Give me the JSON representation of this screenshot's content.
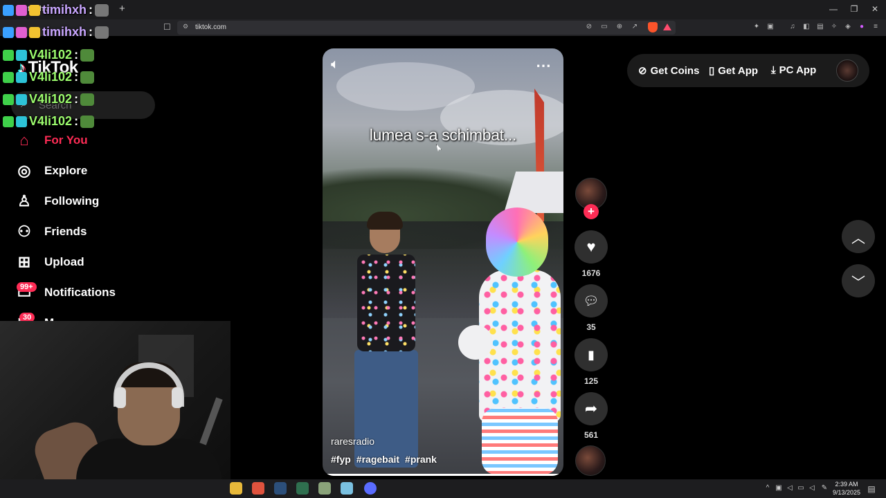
{
  "browser": {
    "tab_title": "timihxh :",
    "new_tab": "+",
    "url": "tiktok.com",
    "window_controls": {
      "minimize": "—",
      "restore": "❐",
      "close": "✕"
    }
  },
  "chat": {
    "lines": [
      {
        "name": "timihxh",
        "sep": ":",
        "color": "#c9a6ff"
      },
      {
        "name": "V4li102",
        "sep": ":",
        "color": "#9dfd6e"
      },
      {
        "name": "V4li102",
        "sep": ":",
        "color": "#9dfd6e"
      },
      {
        "name": "V4li102",
        "sep": ":",
        "color": "#9dfd6e"
      },
      {
        "name": "V4li102",
        "sep": ":",
        "color": "#9dfd6e"
      }
    ]
  },
  "sidebar": {
    "logo": "TikTok",
    "search_placeholder": "Search",
    "items": [
      {
        "label": "For You",
        "icon": "home-icon",
        "active": true
      },
      {
        "label": "Explore",
        "icon": "compass-icon"
      },
      {
        "label": "Following",
        "icon": "following-icon"
      },
      {
        "label": "Friends",
        "icon": "friends-icon"
      },
      {
        "label": "Upload",
        "icon": "upload-icon"
      },
      {
        "label": "Notifications",
        "icon": "notifications-icon",
        "badge": "99+"
      },
      {
        "label": "M",
        "icon": "messages-icon",
        "badge": "30"
      }
    ]
  },
  "video": {
    "caption": "lumea s-a schimbat...",
    "author": "raresradio",
    "tags": [
      "#fyp",
      "#ragebait",
      "#prank"
    ],
    "progress": 0.99
  },
  "actions": {
    "likes": "1676",
    "comments": "35",
    "saves": "125",
    "shares": "561"
  },
  "topright": {
    "coins": "Get Coins",
    "app": "Get App",
    "pc_app": "PC App"
  },
  "taskbar": {
    "time": "2:39 AM",
    "date": "9/13/2025"
  },
  "colors": {
    "accent": "#fe2c55",
    "background": "#000000"
  }
}
